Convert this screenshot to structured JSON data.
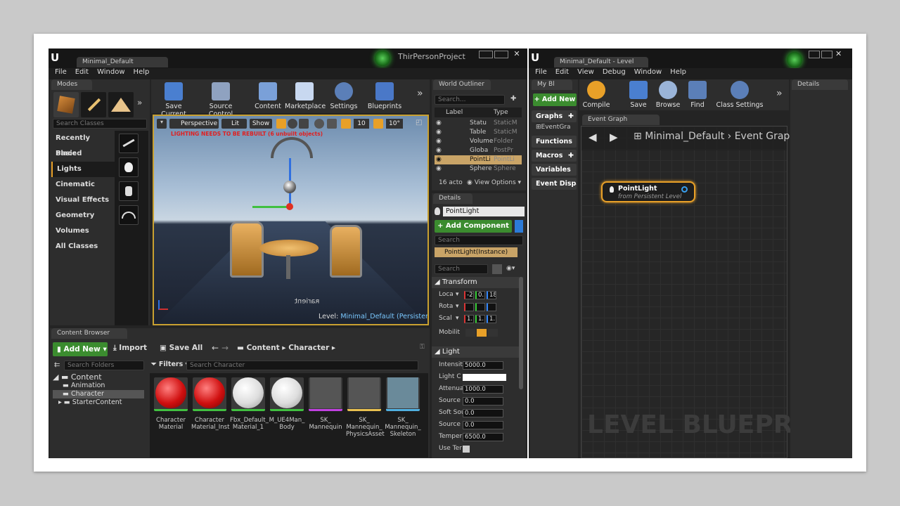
{
  "left_window": {
    "tab_title": "Minimal_Default",
    "project": "ThirPersonProject",
    "menu": [
      "File",
      "Edit",
      "Window",
      "Help"
    ],
    "modes": {
      "tab": "Modes",
      "search_placeholder": "Search Classes",
      "categories": [
        "Recently Placed",
        "Basic",
        "Lights",
        "Cinematic",
        "Visual Effects",
        "Geometry",
        "Volumes",
        "All Classes"
      ],
      "active": "Lights"
    },
    "toolbar": [
      "Save Current",
      "Source Control",
      "Content",
      "Marketplace",
      "Settings",
      "Blueprints"
    ],
    "viewport": {
      "view": "Perspective",
      "lit": "Lit",
      "show": "Show",
      "grid_snap": "10",
      "rot_snap": "10°",
      "warning": "LIGHTING NEEDS TO BE REBUILT (6 unbuilt objects)",
      "level_label": "Level:",
      "level_name": "Minimal_Default (Persistent)"
    },
    "outliner": {
      "tab": "World Outliner",
      "search_placeholder": "Search...",
      "col_label": "Label",
      "col_type": "Type",
      "rows": [
        {
          "label": "Statu",
          "type": "StaticM"
        },
        {
          "label": "Table",
          "type": "StaticM"
        },
        {
          "label": "Volume",
          "type": "Folder"
        },
        {
          "label": "Globa",
          "type": "PostPr"
        },
        {
          "label": "PointLi",
          "type": "PointLi"
        },
        {
          "label": "Sphere",
          "type": "Sphere"
        }
      ],
      "count": "16 acto",
      "view_options": "View Options"
    },
    "details": {
      "tab": "Details",
      "name": "PointLight",
      "add_component": "+ Add Component",
      "search_placeholder": "Search",
      "instance": "PointLight(Instance)",
      "search2_placeholder": "Search",
      "transform_header": "Transform",
      "transform_rows": [
        {
          "label": "Loca",
          "v": [
            "-2",
            "0.",
            "18"
          ]
        },
        {
          "label": "Rota",
          "v": [
            "",
            "",
            ""
          ]
        },
        {
          "label": "Scal",
          "v": [
            "1.",
            "1.",
            "1."
          ]
        }
      ],
      "mobility": "Mobilit",
      "light_header": "Light",
      "light_rows": [
        {
          "label": "Intensit",
          "v": "5000.0"
        },
        {
          "label": "Light C",
          "v": ""
        },
        {
          "label": "Attenua",
          "v": "1000.0"
        },
        {
          "label": "Source",
          "v": "0.0"
        },
        {
          "label": "Soft Sou",
          "v": "0.0"
        },
        {
          "label": "Source",
          "v": "0.0"
        },
        {
          "label": "Temper",
          "v": "6500.0"
        },
        {
          "label": "Use Ter",
          "v": ""
        }
      ]
    },
    "content_browser": {
      "tab": "Content Browser",
      "add_new": "Add New",
      "import": "Import",
      "save_all": "Save All",
      "path": [
        "Content",
        "Character"
      ],
      "search_folders": "Search Folders",
      "filters": "Filters",
      "search_placeholder": "Search Character",
      "tree": [
        "Content",
        "Animation",
        "Character",
        "StarterContent"
      ],
      "assets": [
        {
          "name": "Character Material",
          "kind": "mat-red"
        },
        {
          "name": "Character Material_Inst",
          "kind": "mat-red"
        },
        {
          "name": "Fbx_Default_ Material_1",
          "kind": "mat-white"
        },
        {
          "name": "M_UE4Man_ Body",
          "kind": "mat-white"
        },
        {
          "name": "SK_ Mannequin",
          "kind": "mesh"
        },
        {
          "name": "SK_ Mannequin_ PhysicsAsset",
          "kind": "phys"
        },
        {
          "name": "SK_ Mannequin_ Skeleton",
          "kind": "skel"
        }
      ]
    }
  },
  "right_window": {
    "tab_title": "Minimal_Default - Level",
    "menu": [
      "File",
      "Edit",
      "View",
      "Debug",
      "Window",
      "Help"
    ],
    "my_blueprint": "My Bl",
    "add_new": "+ Add New",
    "toolbar": [
      "Compile",
      "Save",
      "Browse",
      "Find",
      "Class Settings"
    ],
    "sidebar": [
      "Graphs",
      "EventGra",
      "Functions",
      "Macros",
      "Variables",
      "Event Dispatc"
    ],
    "graph_tab": "Event Graph",
    "breadcrumb": [
      "Minimal_Default",
      "Event Grap"
    ],
    "node_title": "PointLight",
    "node_sub": "from Persistent Level",
    "watermark": "LEVEL BLUEPR",
    "details_tab": "Details"
  },
  "colors": {
    "accent_orange": "#e8a028",
    "green": "#3b8c2f",
    "blue": "#2c7bd8"
  }
}
